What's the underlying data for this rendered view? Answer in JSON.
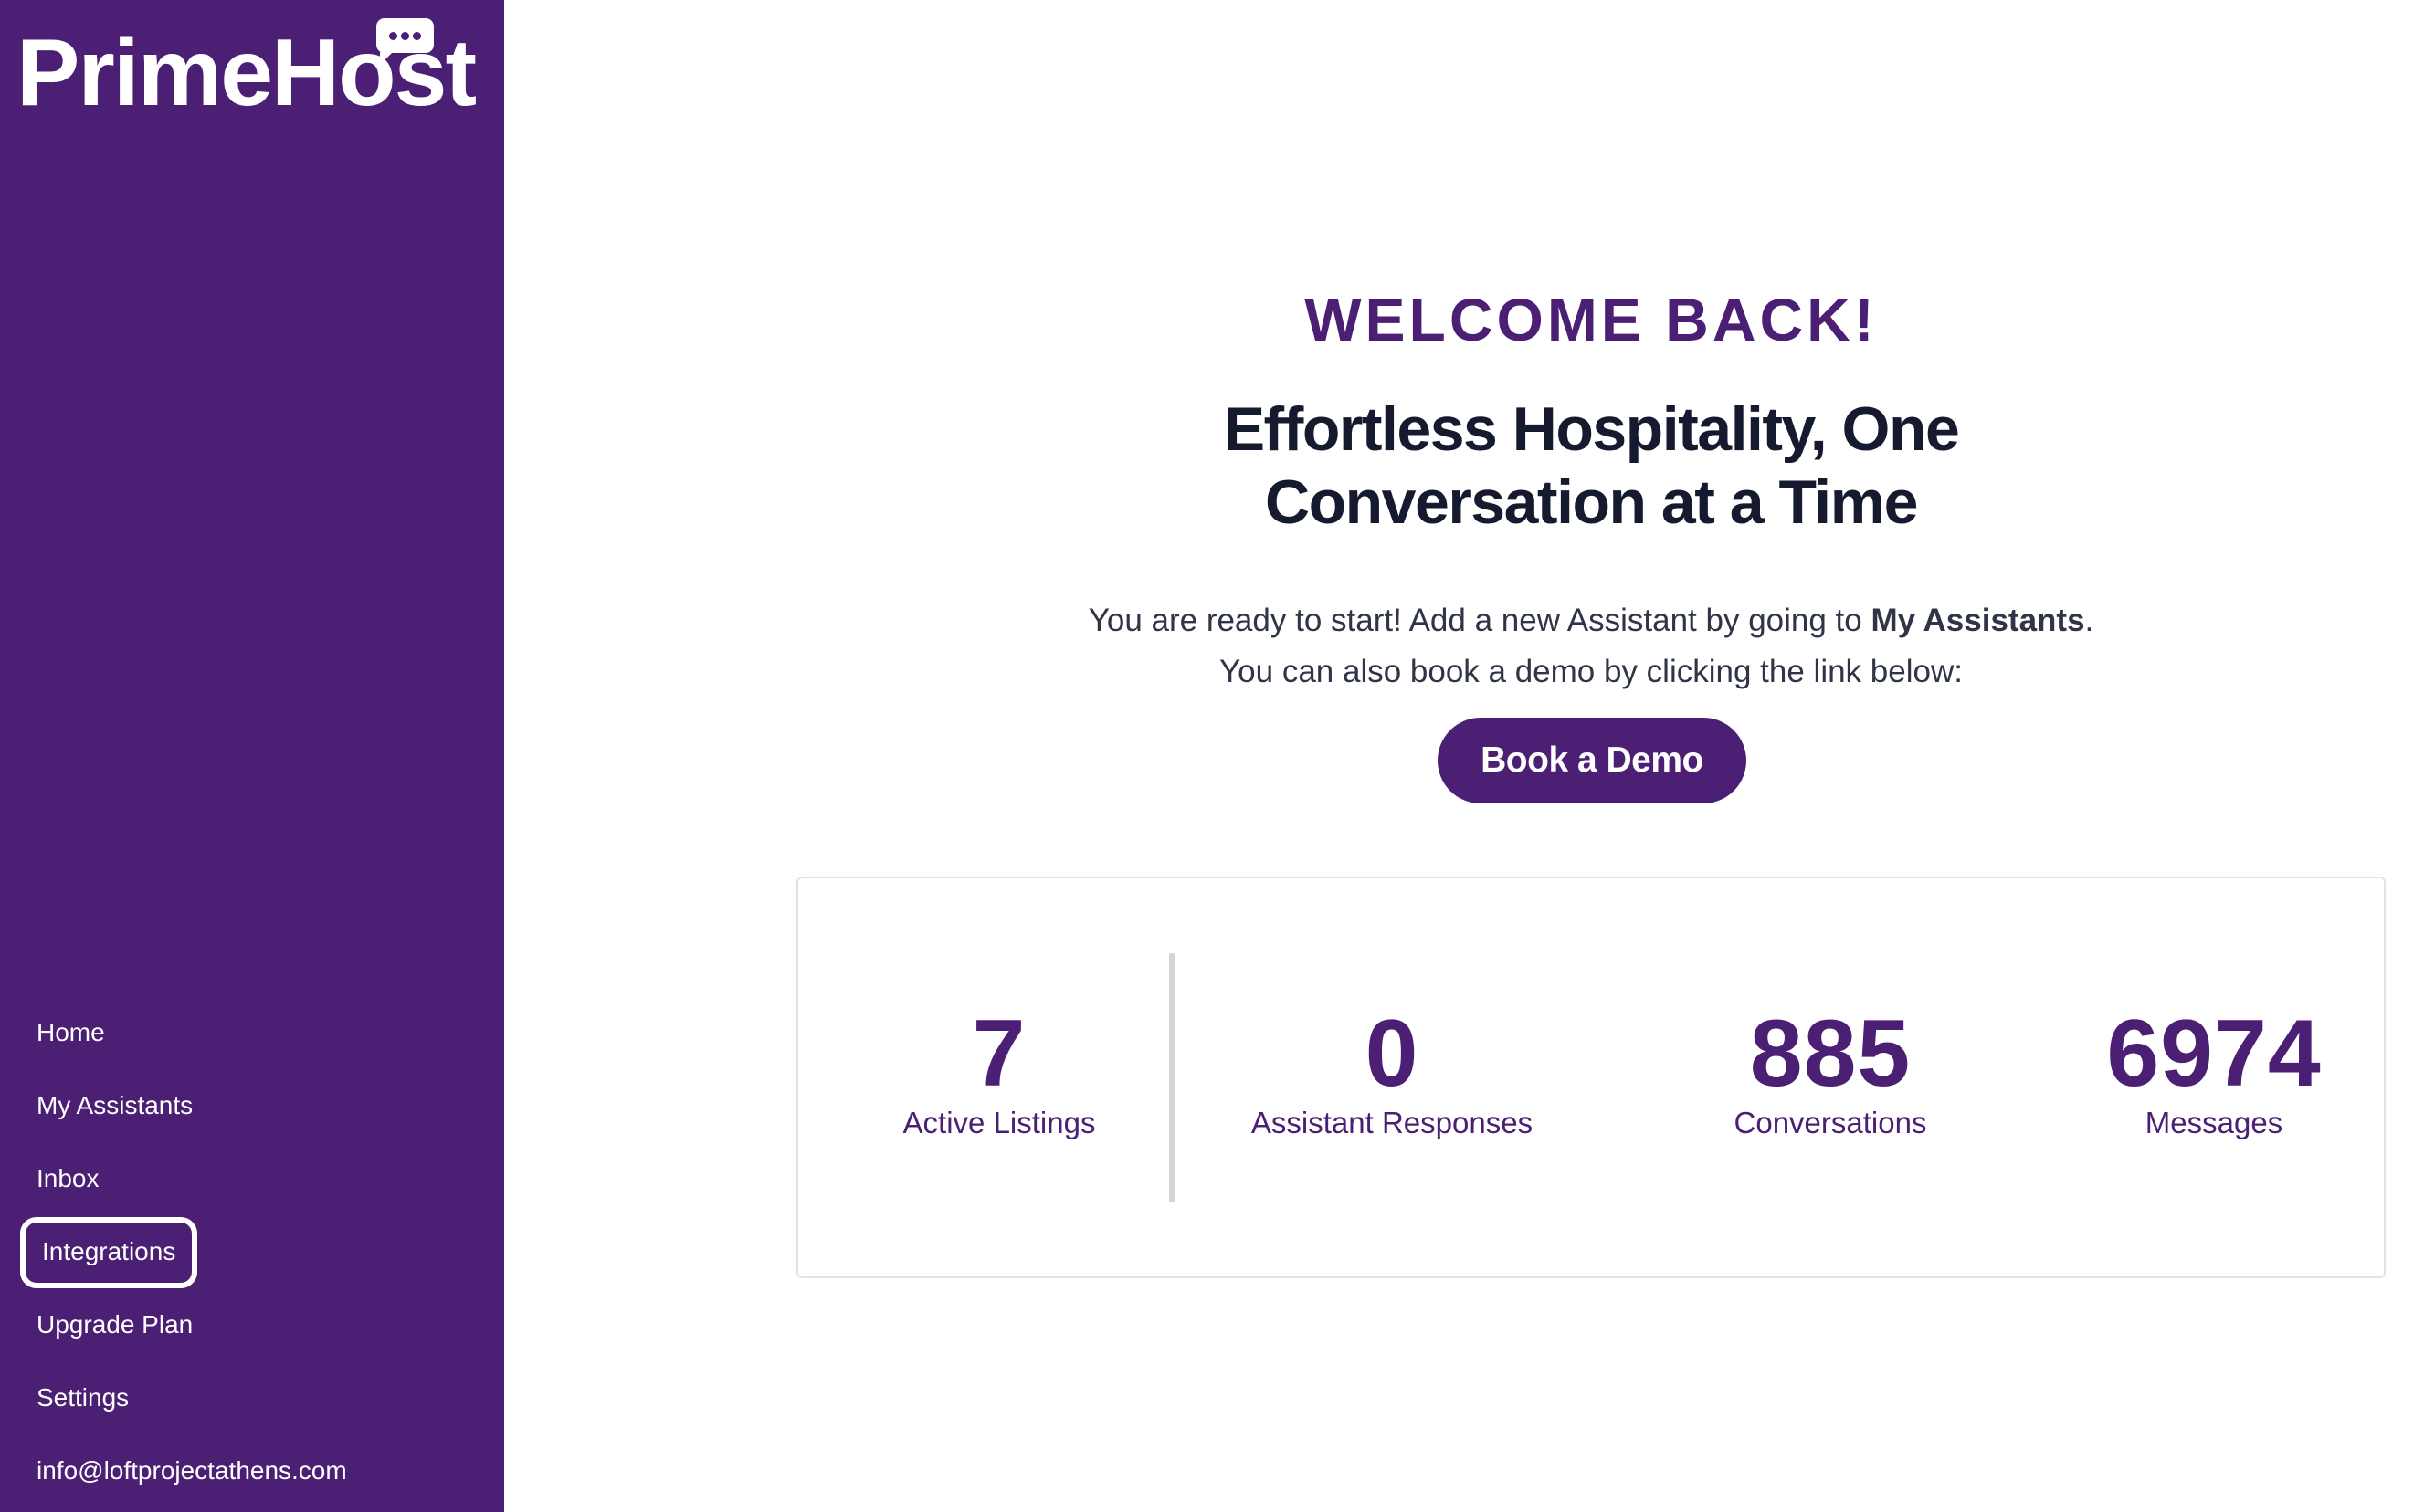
{
  "brand": {
    "name": "PrimeHost",
    "logo_icon": "chat-bubble-icon"
  },
  "sidebar": {
    "items": [
      {
        "label": "Home"
      },
      {
        "label": "My Assistants"
      },
      {
        "label": "Inbox"
      },
      {
        "label": "Integrations",
        "selected": true
      },
      {
        "label": "Upgrade Plan"
      },
      {
        "label": "Settings"
      }
    ],
    "account_email": "info@loftprojectathens.com"
  },
  "main": {
    "welcome": "WELCOME BACK!",
    "headline_line1": "Effortless Hospitality, One",
    "headline_line2": "Conversation at a Time",
    "intro_prefix": "You are ready to start! Add a new Assistant by going to ",
    "intro_bold": "My Assistants",
    "intro_suffix": ".",
    "intro_line2": "You can also book a demo by clicking the link below:",
    "demo_button": "Book a Demo"
  },
  "stats": [
    {
      "value": "7",
      "label": "Active Listings"
    },
    {
      "value": "0",
      "label": "Assistant Responses"
    },
    {
      "value": "885",
      "label": "Conversations"
    },
    {
      "value": "6974",
      "label": "Messages"
    }
  ],
  "colors": {
    "brand_purple": "#4b1f73",
    "heading_dark": "#151a2e",
    "text_gray": "#2f3447",
    "card_border": "#e3e3e3"
  }
}
